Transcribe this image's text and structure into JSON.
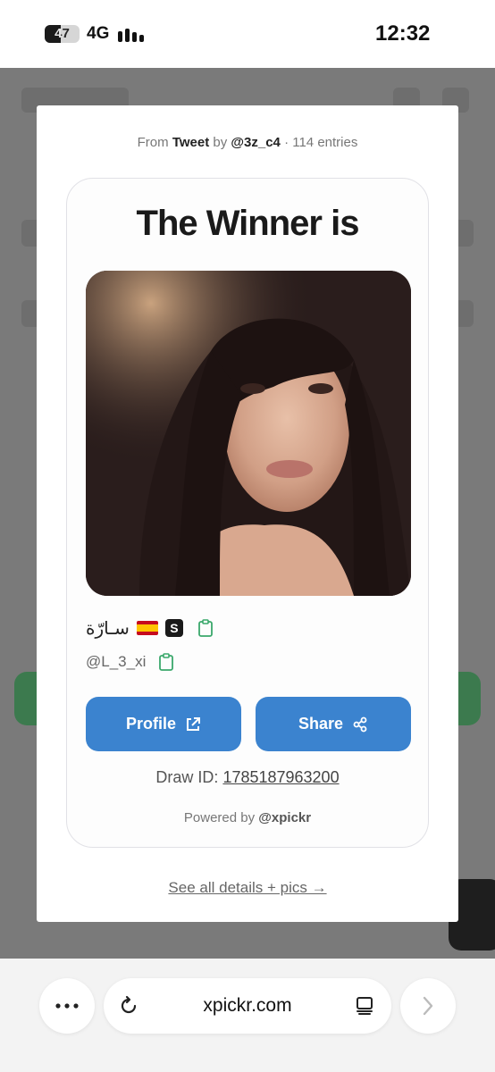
{
  "status_bar": {
    "battery": "47",
    "network": "4G",
    "time": "12:32"
  },
  "modal": {
    "source": {
      "prefix": "From",
      "platform": "Tweet",
      "by": "by",
      "author": "@3z_c4",
      "entries": "· 114 entries"
    },
    "title": "The Winner is",
    "winner": {
      "name": "سـارّة",
      "handle": "@L_3_xi"
    },
    "profile_button": "Profile",
    "share_button": "Share",
    "draw_id_label": "Draw ID:",
    "draw_id": "1785187963200",
    "powered_prefix": "Powered by",
    "powered_brand": "@xpickr",
    "details_link": "See all details + pics →"
  },
  "browser": {
    "url": "xpickr.com"
  },
  "colors": {
    "accent": "#3b83cf",
    "copy_icon": "#3aa86b",
    "backdrop": "#7a7a7a"
  },
  "icons": {
    "battery": "battery-icon",
    "signal": "signal-bars-icon",
    "copy": "clipboard-icon",
    "external_link": "external-link-icon",
    "share": "share-icon",
    "more": "ellipsis-icon",
    "reload": "reload-icon",
    "tabs": "tabs-icon",
    "forward": "chevron-right-icon"
  }
}
